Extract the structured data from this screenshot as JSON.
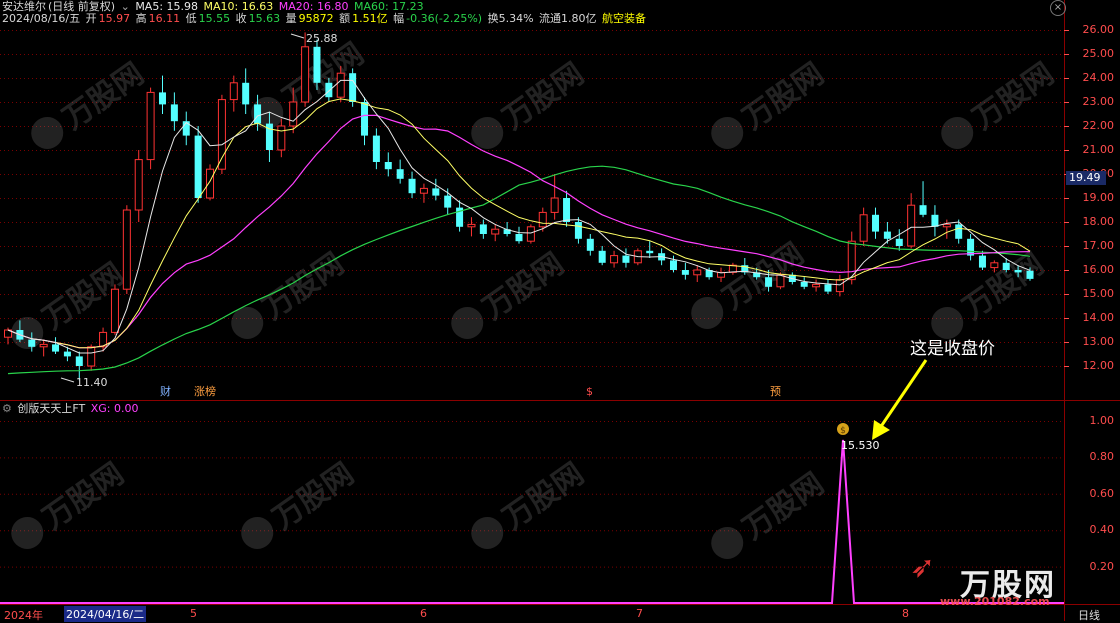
{
  "header": {
    "stock_name": "安达维尔",
    "chart_mode": "(日线 前复权)",
    "ma5_label": "MA5: 15.98",
    "ma10_label": "MA10: 16.63",
    "ma20_label": "MA20: 16.80",
    "ma60_label": "MA60: 17.23",
    "date": "2024/08/16/五",
    "open_label": "开",
    "open_value": "15.97",
    "high_label": "高",
    "high_value": "16.11",
    "low_label": "低",
    "low_value": "15.55",
    "close_label": "收",
    "close_value": "15.63",
    "volume_label": "量",
    "volume_value": "95872",
    "amount_label": "额",
    "amount_value": "1.51亿",
    "change_label": "幅",
    "change_value": "-0.36(-2.25%)",
    "turnover": "换5.34%",
    "float_cap": "流通1.80亿",
    "sector": "航空装备"
  },
  "price_axis": {
    "labels": [
      "26.00",
      "25.00",
      "24.00",
      "23.00",
      "22.00",
      "21.00",
      "20.00",
      "19.00",
      "18.00",
      "17.00",
      "16.00",
      "15.00",
      "14.00",
      "13.00",
      "12.00"
    ],
    "current_price": "19.49"
  },
  "annotations": {
    "high_mark": "25.88",
    "low_mark": "11.40",
    "signal_value": "15.530",
    "callout": "这是收盘价"
  },
  "markers": {
    "cai": "财",
    "zhangting": "涨榜",
    "dollar": "$",
    "yu": "预"
  },
  "indicator": {
    "name": "创版天天上FT",
    "xg_label": "XG: 0.00",
    "axis_labels": [
      "1.00",
      "0.80",
      "0.60",
      "0.40",
      "0.20"
    ]
  },
  "date_bar": {
    "year": "2024年",
    "selected_date": "2024/04/16/二",
    "months": [
      "5",
      "6",
      "7",
      "8"
    ],
    "period": "日线"
  },
  "watermark": {
    "brand": "万股网",
    "url": "www.201082.com"
  },
  "colors": {
    "up": "#ff3333",
    "down": "#54ffff",
    "ma5": "#e8e8e8",
    "ma10": "#ffff66",
    "ma20": "#ff40ff",
    "ma60": "#29d34b",
    "grid": "#7a0000",
    "signal": "#ff40ff"
  }
}
